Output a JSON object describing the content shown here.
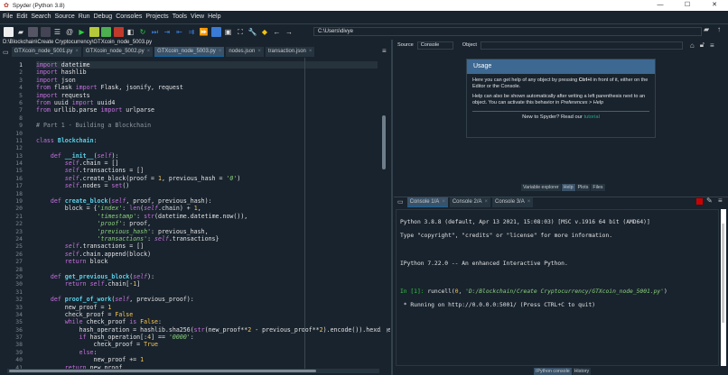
{
  "window": {
    "title": "Spyder (Python 3.8)",
    "controls": [
      "—",
      "☐",
      "✕"
    ]
  },
  "menu": [
    "File",
    "Edit",
    "Search",
    "Source",
    "Run",
    "Debug",
    "Consoles",
    "Projects",
    "Tools",
    "View",
    "Help"
  ],
  "toolbar": {
    "path": "C:\\Users\\divye"
  },
  "editor": {
    "file_path": "D:\\Blockchain\\Create Cryptocurrency\\GTXcoin_node_5003.py",
    "tabs": [
      {
        "label": "GTXcoin_node_5001.py"
      },
      {
        "label": "GTXcoin_node_5002.py"
      },
      {
        "label": "GTXcoin_node_5003.py",
        "active": true
      },
      {
        "label": "nodes.json"
      },
      {
        "label": "transaction.json"
      }
    ],
    "lines": [
      [
        [
          "k",
          "import"
        ],
        [
          "n",
          " datetime"
        ]
      ],
      [
        [
          "k",
          "import"
        ],
        [
          "n",
          " hashlib"
        ]
      ],
      [
        [
          "k",
          "import"
        ],
        [
          "n",
          " json"
        ]
      ],
      [
        [
          "k",
          "from"
        ],
        [
          "n",
          " flask "
        ],
        [
          "k",
          "import"
        ],
        [
          "n",
          " Flask, jsonify, request"
        ]
      ],
      [
        [
          "k",
          "import"
        ],
        [
          "n",
          " requests"
        ]
      ],
      [
        [
          "k",
          "from"
        ],
        [
          "n",
          " uuid "
        ],
        [
          "k",
          "import"
        ],
        [
          "n",
          " uuid4"
        ]
      ],
      [
        [
          "k",
          "from"
        ],
        [
          "n",
          " urllib.parse "
        ],
        [
          "k",
          "import"
        ],
        [
          "n",
          " urlparse"
        ]
      ],
      [],
      [
        [
          "c",
          "# Part 1 - Building a Blockchain"
        ]
      ],
      [],
      [
        [
          "k",
          "class"
        ],
        [
          "n",
          " "
        ],
        [
          "f",
          "Blockchain"
        ],
        [
          "n",
          ":"
        ]
      ],
      [],
      [
        [
          "n",
          "    "
        ],
        [
          "k",
          "def"
        ],
        [
          "n",
          " "
        ],
        [
          "f",
          "__init__"
        ],
        [
          "n",
          "("
        ],
        [
          "se",
          "self"
        ],
        [
          "n",
          "):"
        ]
      ],
      [
        [
          "n",
          "        "
        ],
        [
          "se",
          "self"
        ],
        [
          "n",
          ".chain = []"
        ]
      ],
      [
        [
          "n",
          "        "
        ],
        [
          "se",
          "self"
        ],
        [
          "n",
          ".transactions = []"
        ]
      ],
      [
        [
          "n",
          "        "
        ],
        [
          "se",
          "self"
        ],
        [
          "n",
          ".create_block(proof = "
        ],
        [
          "nu",
          "1"
        ],
        [
          "n",
          ", previous_hash = "
        ],
        [
          "s",
          "'0'"
        ],
        [
          "n",
          ")"
        ]
      ],
      [
        [
          "n",
          "        "
        ],
        [
          "se",
          "self"
        ],
        [
          "n",
          ".nodes = "
        ],
        [
          "b",
          "set"
        ],
        [
          "n",
          "()"
        ]
      ],
      [],
      [
        [
          "n",
          "    "
        ],
        [
          "k",
          "def"
        ],
        [
          "n",
          " "
        ],
        [
          "f",
          "create_block"
        ],
        [
          "n",
          "("
        ],
        [
          "se",
          "self"
        ],
        [
          "n",
          ", proof, previous_hash):"
        ]
      ],
      [
        [
          "n",
          "        block = {"
        ],
        [
          "s",
          "'index'"
        ],
        [
          "n",
          ": "
        ],
        [
          "b",
          "len"
        ],
        [
          "n",
          "("
        ],
        [
          "se",
          "self"
        ],
        [
          "n",
          ".chain) + "
        ],
        [
          "nu",
          "1"
        ],
        [
          "n",
          ","
        ]
      ],
      [
        [
          "n",
          "                 "
        ],
        [
          "s",
          "'timestamp'"
        ],
        [
          "n",
          ": "
        ],
        [
          "b",
          "str"
        ],
        [
          "n",
          "(datetime.datetime.now()),"
        ]
      ],
      [
        [
          "n",
          "                 "
        ],
        [
          "s",
          "'proof'"
        ],
        [
          "n",
          ": proof,"
        ]
      ],
      [
        [
          "n",
          "                 "
        ],
        [
          "s",
          "'previous_hash'"
        ],
        [
          "n",
          ": previous_hash,"
        ]
      ],
      [
        [
          "n",
          "                 "
        ],
        [
          "s",
          "'transactions'"
        ],
        [
          "n",
          ": "
        ],
        [
          "se",
          "self"
        ],
        [
          "n",
          ".transactions}"
        ]
      ],
      [
        [
          "n",
          "        "
        ],
        [
          "se",
          "self"
        ],
        [
          "n",
          ".transactions = []"
        ]
      ],
      [
        [
          "n",
          "        "
        ],
        [
          "se",
          "self"
        ],
        [
          "n",
          ".chain.append(block)"
        ]
      ],
      [
        [
          "n",
          "        "
        ],
        [
          "k",
          "return"
        ],
        [
          "n",
          " block"
        ]
      ],
      [],
      [
        [
          "n",
          "    "
        ],
        [
          "k",
          "def"
        ],
        [
          "n",
          " "
        ],
        [
          "f",
          "get_previous_block"
        ],
        [
          "n",
          "("
        ],
        [
          "se",
          "self"
        ],
        [
          "n",
          "):"
        ]
      ],
      [
        [
          "n",
          "        "
        ],
        [
          "k",
          "return"
        ],
        [
          "n",
          " "
        ],
        [
          "se",
          "self"
        ],
        [
          "n",
          ".chain[-"
        ],
        [
          "nu",
          "1"
        ],
        [
          "n",
          "]"
        ]
      ],
      [],
      [
        [
          "n",
          "    "
        ],
        [
          "k",
          "def"
        ],
        [
          "n",
          " "
        ],
        [
          "f",
          "proof_of_work"
        ],
        [
          "n",
          "("
        ],
        [
          "se",
          "self"
        ],
        [
          "n",
          ", previous_proof):"
        ]
      ],
      [
        [
          "n",
          "        new_proof = "
        ],
        [
          "nu",
          "1"
        ]
      ],
      [
        [
          "n",
          "        check_proof = "
        ],
        [
          "nu",
          "False"
        ]
      ],
      [
        [
          "n",
          "        "
        ],
        [
          "k",
          "while"
        ],
        [
          "n",
          " check_proof "
        ],
        [
          "k",
          "is"
        ],
        [
          "n",
          " "
        ],
        [
          "nu",
          "False"
        ],
        [
          "n",
          ":"
        ]
      ],
      [
        [
          "n",
          "            hash_operation = hashlib.sha256("
        ],
        [
          "b",
          "str"
        ],
        [
          "n",
          "(new_proof**"
        ],
        [
          "nu",
          "2"
        ],
        [
          "n",
          " - previous_proof**"
        ],
        [
          "nu",
          "2"
        ],
        [
          "n",
          ").encode()).hexdiges"
        ]
      ],
      [
        [
          "n",
          "            "
        ],
        [
          "k",
          "if"
        ],
        [
          "n",
          " hash_operation[:"
        ],
        [
          "nu",
          "4"
        ],
        [
          "n",
          "] == "
        ],
        [
          "s",
          "'0000'"
        ],
        [
          "n",
          ":"
        ]
      ],
      [
        [
          "n",
          "                check_proof = "
        ],
        [
          "nu",
          "True"
        ]
      ],
      [
        [
          "n",
          "            "
        ],
        [
          "k",
          "else"
        ],
        [
          "n",
          ":"
        ]
      ],
      [
        [
          "n",
          "                new_proof += "
        ],
        [
          "nu",
          "1"
        ]
      ],
      [
        [
          "n",
          "        "
        ],
        [
          "k",
          "return"
        ],
        [
          "n",
          " new_proof"
        ]
      ]
    ]
  },
  "help": {
    "source_label": "Source",
    "source_value": "Console",
    "object_label": "Object",
    "usage_title": "Usage",
    "p1a": "Here you can get help of any object by pressing ",
    "p1b": "Ctrl+I",
    "p1c": " in front of it, either on the Editor or the Console.",
    "p2a": "Help can also be shown automatically after writing a left parenthesis next to an object. You can activate this behavior in ",
    "p2b": "Preferences > Help",
    "p3a": "New to Spyder? Read our ",
    "p3b": "tutorial",
    "tabs": [
      "Variable explorer",
      "Help",
      "Plots",
      "Files"
    ]
  },
  "console": {
    "tabs": [
      "Console 1/A",
      "Console 2/A",
      "Console 3/A"
    ],
    "line1": "Python 3.8.8 (default, Apr 13 2021, 15:08:03) [MSC v.1916 64 bit (AMD64)]",
    "line2": "Type \"copyright\", \"credits\" or \"license\" for more information.",
    "line3": "IPython 7.22.0 -- An enhanced Interactive Python.",
    "prompt": "In [1]: ",
    "cmd": "runcell(",
    "cmd_num": "0",
    "cmd_sep": ", ",
    "cmd_str": "'D:/Blockchain/Create Cryptocurrency/GTXcoin_node_5001.py'",
    "cmd_end": ")",
    "line5": " * Running on http://0.0.0.0:5001/ (Press CTRL+C to quit)",
    "bottom_tabs": [
      "IPython console",
      "History"
    ]
  },
  "colors": {
    "bg": "#19232d",
    "accent": "#3d6891"
  }
}
